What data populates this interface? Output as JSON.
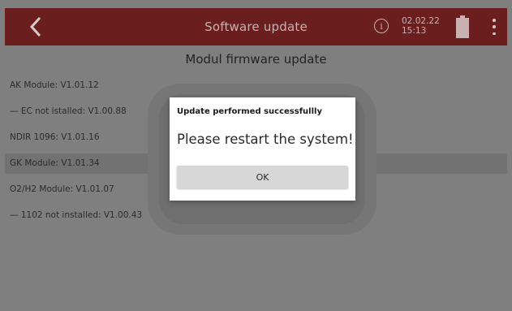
{
  "header": {
    "title": "Software update",
    "date": "02.02.22",
    "time": "15:13",
    "back_icon": "chevron-left-icon",
    "info_icon": "info-icon",
    "info_glyph": "i",
    "battery_icon": "battery-icon",
    "menu_icon": "more-vertical-icon",
    "background_color": "#6a1e1e"
  },
  "content": {
    "section_title": "Modul firmware update",
    "modules": [
      {
        "label": "AK Module: V1.01.12",
        "selected": false
      },
      {
        "label": "— EC not istalled: V1.00.88",
        "selected": false
      },
      {
        "label": "NDIR 1096: V1.01.16",
        "selected": false
      },
      {
        "label": "GK Module: V1.01.34",
        "selected": true
      },
      {
        "label": "O2/H2 Module: V1.01.07",
        "selected": false
      },
      {
        "label": "— 1102 not installed: V1.00.43",
        "selected": false
      }
    ]
  },
  "dialog": {
    "title": "Update performed successfullly",
    "message": "Please restart the system!",
    "ok_label": "OK"
  }
}
